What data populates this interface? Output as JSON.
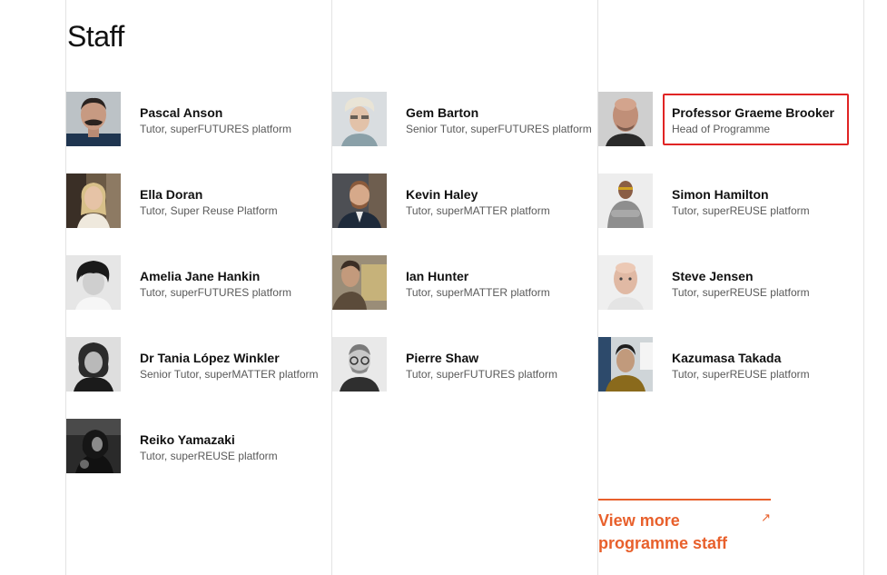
{
  "page": {
    "title": "Staff"
  },
  "staff": [
    {
      "name": "Pascal Anson",
      "role": "Tutor, superFUTURES platform",
      "photo": "person-photo"
    },
    {
      "name": "Ella Doran",
      "role": "Tutor, Super Reuse Platform",
      "photo": "person-photo"
    },
    {
      "name": "Amelia Jane Hankin",
      "role": "Tutor, superFUTURES platform",
      "photo": "person-photo"
    },
    {
      "name": "Dr Tania López Winkler",
      "role": "Senior Tutor, superMATTER platform",
      "photo": "person-photo"
    },
    {
      "name": "Reiko Yamazaki",
      "role": "Tutor, superREUSE platform",
      "photo": "person-photo"
    },
    {
      "name": "Gem Barton",
      "role": "Senior Tutor, superFUTURES platform",
      "photo": "person-photo"
    },
    {
      "name": "Kevin Haley",
      "role": "Tutor, superMATTER platform",
      "photo": "person-photo"
    },
    {
      "name": "Ian Hunter",
      "role": "Tutor, superMATTER platform",
      "photo": "person-photo"
    },
    {
      "name": "Pierre Shaw",
      "role": "Tutor, superFUTURES platform",
      "photo": "person-photo"
    },
    {
      "name": "Professor Graeme Brooker",
      "role": "Head of Programme",
      "photo": "person-photo"
    },
    {
      "name": "Simon Hamilton",
      "role": "Tutor, superREUSE platform",
      "photo": "person-photo"
    },
    {
      "name": "Steve Jensen",
      "role": "Tutor, superREUSE platform",
      "photo": "person-photo"
    },
    {
      "name": "Kazumasa Takada",
      "role": "Tutor, superREUSE platform",
      "photo": "person-photo"
    }
  ],
  "more_link": {
    "label": "View more programme staff",
    "icon": "arrow-up-right-icon",
    "color": "#e8602c"
  },
  "colors": {
    "highlight": "#e02424",
    "divider": "#e3e3e3"
  }
}
